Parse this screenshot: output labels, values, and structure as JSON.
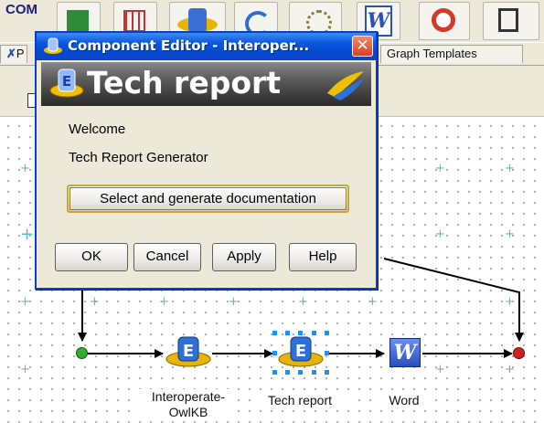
{
  "toolbar": {
    "com_label": "COM",
    "word_label": "W"
  },
  "tabs": {
    "left_partial": "P",
    "graph_templates": "Graph Templates"
  },
  "dialog": {
    "title": "Component Editor - Interoper...",
    "close_glyph": "✕",
    "banner_title": "Tech report",
    "welcome": "Welcome",
    "subtitle": "Tech Report Generator",
    "select_button": "Select and generate documentation",
    "ok": "OK",
    "cancel": "Cancel",
    "apply": "Apply",
    "help": "Help"
  },
  "workflow": {
    "nodes": [
      {
        "label": "Interoperate-OwlKB",
        "line1": "Interoperate-",
        "line2": "OwlKB",
        "icon": "interoperate-icon"
      },
      {
        "label": "Tech report",
        "icon": "tech-report-icon",
        "selected": true
      },
      {
        "label": "Word",
        "icon": "word-icon",
        "glyph": "W"
      }
    ],
    "start_color": "#2fae2f",
    "end_color": "#d22020"
  }
}
